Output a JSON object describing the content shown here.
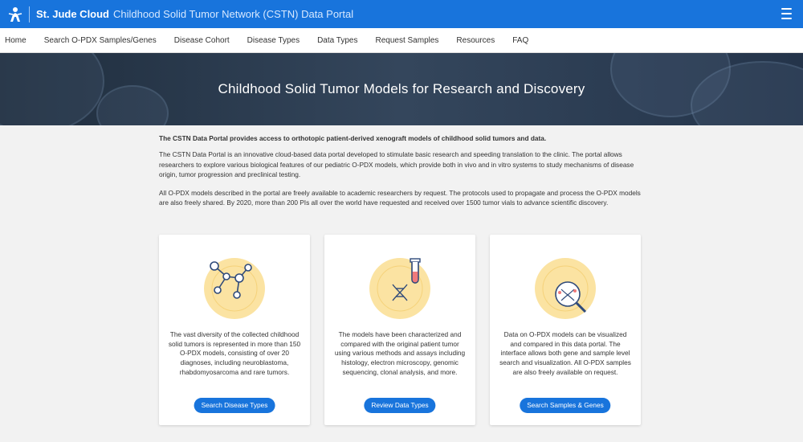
{
  "header": {
    "brand": "St. Jude Cloud",
    "portal_title": "Childhood Solid Tumor Network (CSTN) Data Portal",
    "logo_icon": "st-jude-child-icon",
    "menu_icon": "hamburger-menu-icon",
    "color": "#1874dc"
  },
  "nav": {
    "items": [
      "Home",
      "Search O-PDX Samples/Genes",
      "Disease Cohort",
      "Disease Types",
      "Data Types",
      "Request Samples",
      "Resources",
      "FAQ"
    ]
  },
  "hero": {
    "title": "Childhood Solid Tumor Models for Research and Discovery"
  },
  "intro": {
    "lead": "The CSTN Data Portal provides access to orthotopic patient-derived xenograft models of childhood solid tumors and data.",
    "p1": "The CSTN Data Portal is an innovative cloud-based data portal developed to stimulate basic research and speeding translation to the clinic. The portal allows researchers to explore various biological features of our pediatric O-PDX models, which provide both in vivo and in vitro systems to study mechanisms of disease origin, tumor progression and preclinical testing.",
    "p2": "All O-PDX models described in the portal are freely available to academic researchers by request. The protocols used to propagate and process the O-PDX models are also freely shared. By 2020, more than 200 PIs all over the world have requested and received over 1500 tumor vials to advance scientific discovery."
  },
  "cards": [
    {
      "icon": "molecule-network-icon",
      "text": "The vast diversity of the collected childhood solid tumors is represented in more than 150 O-PDX models, consisting of over 20 diagnoses, including neuroblastoma, rhabdomyosarcoma and rare tumors.",
      "button": "Search Disease Types"
    },
    {
      "icon": "test-tube-dna-icon",
      "text": "The models have been characterized and compared with the original patient tumor using various methods and assays including histology, electron microscopy, genomic sequencing, clonal analysis, and more.",
      "button": "Review Data Types"
    },
    {
      "icon": "magnifier-dna-icon",
      "text": "Data on O-PDX models can be visualized and compared in this data portal. The interface allows both gene and sample level search and visualization. All O-PDX samples are also freely available on request.",
      "button": "Search Samples & Genes"
    }
  ]
}
